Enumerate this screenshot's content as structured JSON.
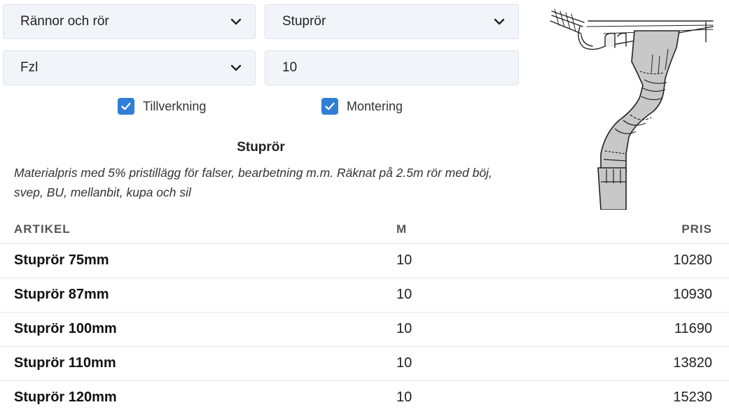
{
  "filters": {
    "category": {
      "value": "Rännor och rör"
    },
    "product": {
      "value": "Stuprör"
    },
    "material": {
      "value": "Fzl"
    },
    "length": {
      "value": "10"
    }
  },
  "options": {
    "tillverkning": {
      "label": "Tillverkning",
      "checked": true
    },
    "montering": {
      "label": "Montering",
      "checked": true
    }
  },
  "section": {
    "title": "Stuprör",
    "description": "Materialpris med 5% pristillägg för falser, bearbetning m.m. Räknat på 2.5m rör med böj, svep, BU, mellanbit, kupa och sil"
  },
  "table": {
    "headers": {
      "artikel": "ARTIKEL",
      "m": "M",
      "pris": "PRIS"
    },
    "rows": [
      {
        "artikel": "Stuprör 75mm",
        "m": "10",
        "pris": "10280"
      },
      {
        "artikel": "Stuprör 87mm",
        "m": "10",
        "pris": "10930"
      },
      {
        "artikel": "Stuprör 100mm",
        "m": "10",
        "pris": "11690"
      },
      {
        "artikel": "Stuprör 110mm",
        "m": "10",
        "pris": "13820"
      },
      {
        "artikel": "Stuprör 120mm",
        "m": "10",
        "pris": "15230"
      }
    ]
  },
  "colors": {
    "checkbox": "#2f7fd6",
    "field_bg": "#f1f5f9",
    "pipe_fill": "#c8c8c8"
  },
  "icons": {
    "select_caret": "chevron-down-icon",
    "checkbox": "check-icon"
  }
}
